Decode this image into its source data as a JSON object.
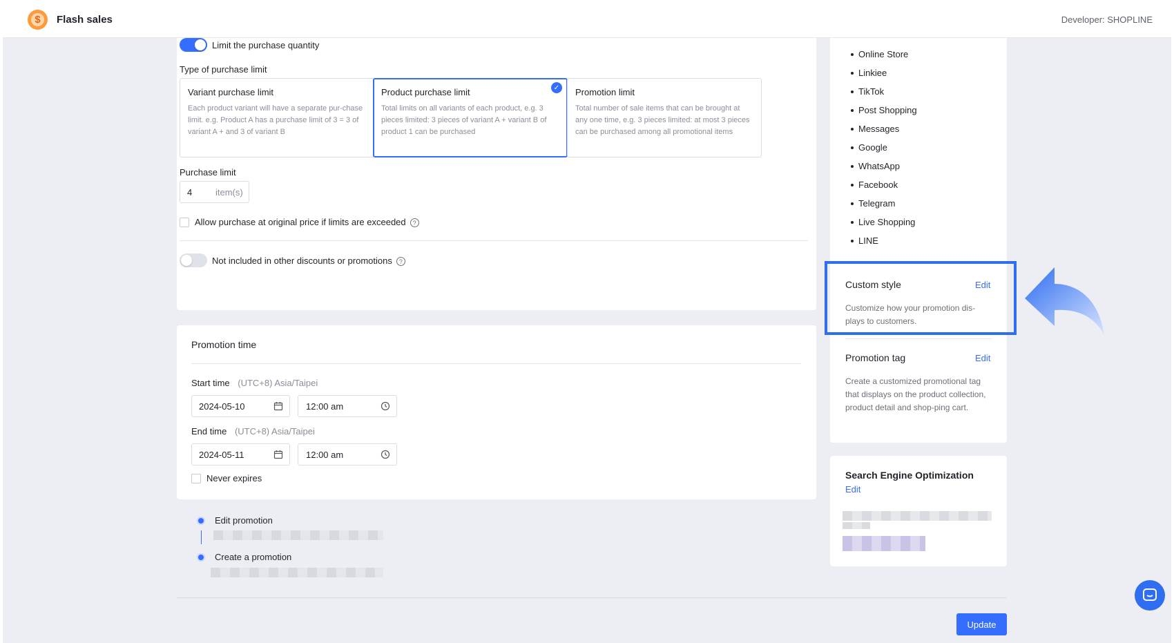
{
  "header": {
    "app_title": "Flash sales",
    "developer": "Developer: SHOPLINE",
    "logo_icon": "dollar-alarm-icon"
  },
  "limits": {
    "limit_toggle_label": "Limit the purchase quantity",
    "limit_toggle_on": true,
    "type_heading": "Type of purchase limit",
    "options": [
      {
        "title": "Variant purchase limit",
        "desc": "Each product variant will have a separate pur-chase limit. e.g. Product A has a purchase limit of 3 = 3 of variant A + and 3 of variant B",
        "selected": false
      },
      {
        "title": "Product purchase limit",
        "desc": "Total limits on all variants of each product, e.g. 3 pieces limited: 3 pieces of variant A + variant B of product 1 can be purchased",
        "selected": true
      },
      {
        "title": "Promotion limit",
        "desc": "Total number of sale items that can be brought at any one time, e.g. 3 pieces limited: at most 3 pieces can be purchased among all promotional items",
        "selected": false
      }
    ],
    "purchase_limit_label": "Purchase limit",
    "purchase_limit_value": "4",
    "purchase_limit_unit": "item(s)",
    "allow_original_price_label": "Allow purchase at original price if limits are exceeded",
    "allow_original_price_checked": false,
    "not_included_label": "Not included in other discounts or promotions",
    "not_included_on": false
  },
  "promotion_time": {
    "title": "Promotion time",
    "start_label": "Start time",
    "end_label": "End time",
    "timezone": "(UTC+8) Asia/Taipei",
    "start_date": "2024-05-10",
    "start_time": "12:00 am",
    "end_date": "2024-05-11",
    "end_time": "12:00 am",
    "never_expires_label": "Never expires",
    "never_expires_checked": false
  },
  "history": {
    "items": [
      {
        "label": "Edit promotion"
      },
      {
        "label": "Create a promotion"
      }
    ]
  },
  "sidebar": {
    "channels": [
      "Online Store",
      "Linkiee",
      "TikTok",
      "Post Shopping",
      "Messages",
      "Google",
      "WhatsApp",
      "Facebook",
      "Telegram",
      "Live Shopping",
      "LINE"
    ],
    "custom_style": {
      "title": "Custom style",
      "edit": "Edit",
      "desc": "Customize how your promotion dis-plays to customers."
    },
    "promotion_tag": {
      "title": "Promotion tag",
      "edit": "Edit",
      "desc": "Create a customized promotional tag that displays on the product collection, product detail and shop-ping cart."
    },
    "seo": {
      "title": "Search Engine Optimization",
      "edit": "Edit"
    }
  },
  "footer": {
    "update_label": "Update"
  },
  "colors": {
    "accent": "#356dff",
    "highlight": "#2f6ef0",
    "background": "#eceef3"
  }
}
